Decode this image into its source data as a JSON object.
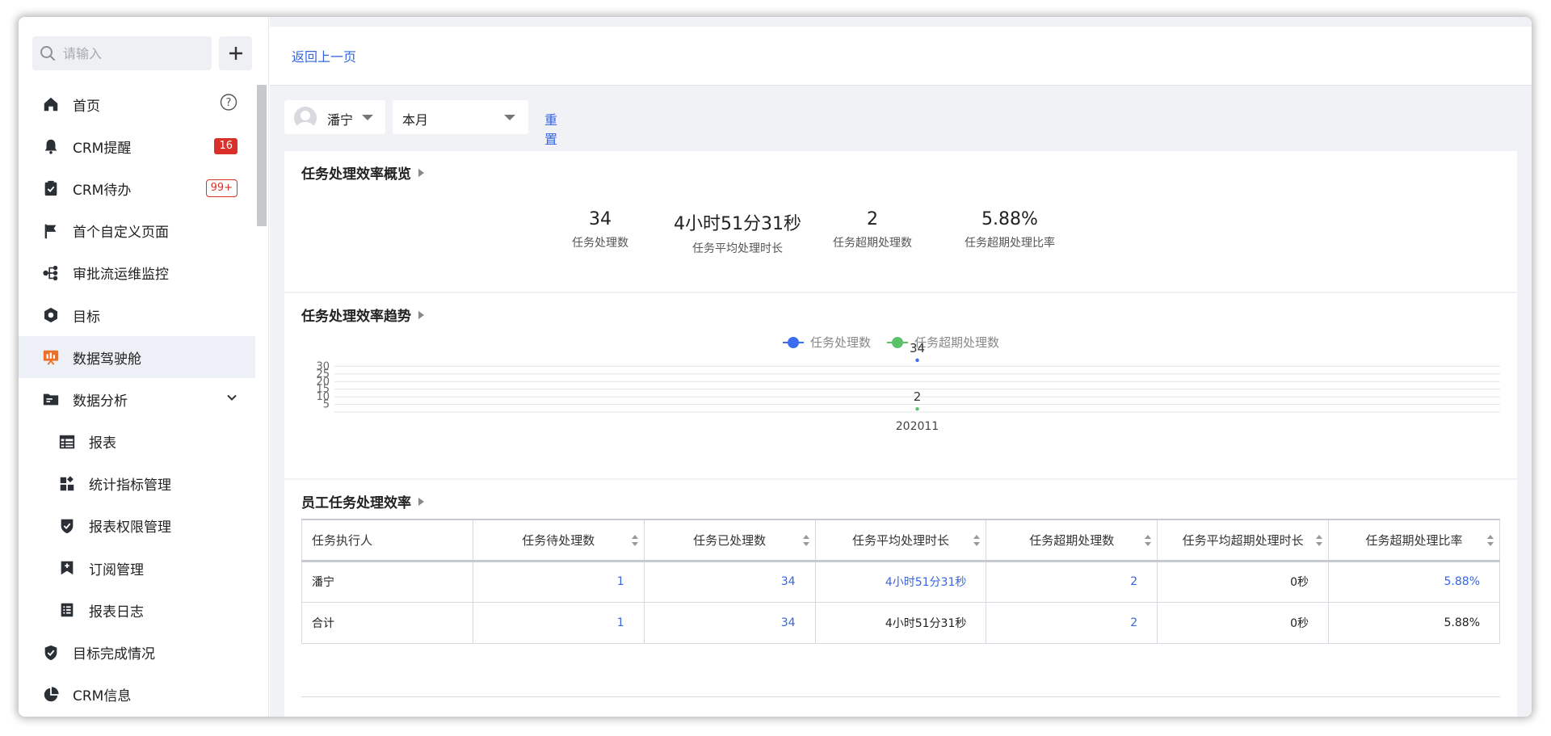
{
  "sidebar": {
    "search_placeholder": "请输入",
    "items": [
      {
        "label": "首页",
        "icon": "home-icon"
      },
      {
        "label": "CRM提醒",
        "icon": "bell-icon",
        "badge": "16"
      },
      {
        "label": "CRM待办",
        "icon": "clipboard-check-icon",
        "badge": "99+"
      },
      {
        "label": "首个自定义页面",
        "icon": "flag-icon"
      },
      {
        "label": "审批流运维监控",
        "icon": "flow-icon"
      },
      {
        "label": "目标",
        "icon": "target-icon"
      },
      {
        "label": "数据驾驶舱",
        "icon": "dashboard-icon"
      },
      {
        "label": "数据分析",
        "icon": "folder-icon"
      },
      {
        "label": "报表",
        "icon": "table-icon"
      },
      {
        "label": "统计指标管理",
        "icon": "widgets-icon"
      },
      {
        "label": "报表权限管理",
        "icon": "shield-check-icon"
      },
      {
        "label": "订阅管理",
        "icon": "bookmark-add-icon"
      },
      {
        "label": "报表日志",
        "icon": "list-icon"
      },
      {
        "label": "目标完成情况",
        "icon": "verified-icon"
      },
      {
        "label": "CRM信息",
        "icon": "pie-icon"
      }
    ],
    "active_index": 6
  },
  "topbar": {
    "back_label": "返回上一页"
  },
  "filters": {
    "person": "潘宁",
    "period": "本月",
    "reset_label": "重置"
  },
  "overview": {
    "title": "任务处理效率概览",
    "stats": [
      {
        "value": "34",
        "label": "任务处理数"
      },
      {
        "value": "4小时51分31秒",
        "label": "任务平均处理时长"
      },
      {
        "value": "2",
        "label": "任务超期处理数"
      },
      {
        "value": "5.88%",
        "label": "任务超期处理比率"
      }
    ]
  },
  "trend": {
    "title": "任务处理效率趋势"
  },
  "chart_data": {
    "type": "line",
    "categories": [
      "202011"
    ],
    "series": [
      {
        "name": "任务处理数",
        "values": [
          34
        ],
        "color": "#3b6df0"
      },
      {
        "name": "任务超期处理数",
        "values": [
          2
        ],
        "color": "#5cc16a"
      }
    ],
    "yticks": [
      "5",
      "10",
      "15",
      "20",
      "25",
      "30"
    ],
    "ylim": [
      0,
      35
    ],
    "legend": "top-center",
    "grid": true
  },
  "employee": {
    "title": "员工任务处理效率",
    "columns": [
      "任务执行人",
      "任务待处理数",
      "任务已处理数",
      "任务平均处理时长",
      "任务超期处理数",
      "任务平均超期处理时长",
      "任务超期处理比率"
    ],
    "rows": [
      [
        "潘宁",
        "1",
        "34",
        "4小时51分31秒",
        "2",
        "0秒",
        "5.88%"
      ],
      [
        "合计",
        "1",
        "34",
        "4小时51分31秒",
        "2",
        "0秒",
        "5.88%"
      ]
    ]
  }
}
